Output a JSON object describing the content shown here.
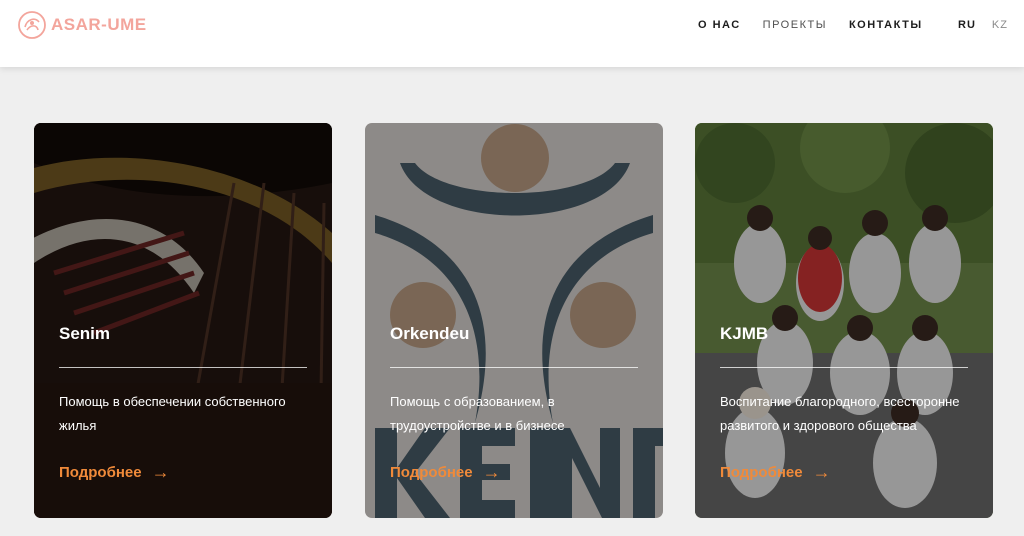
{
  "header": {
    "logo_text": "ASAR-UME",
    "nav": [
      {
        "label": "О НАС"
      },
      {
        "label": "ПРОЕКТЫ"
      },
      {
        "label": "КОНТАКТЫ"
      }
    ],
    "languages": [
      {
        "label": "RU",
        "active": true
      },
      {
        "label": "KZ",
        "active": false
      }
    ]
  },
  "cards": [
    {
      "title": "Senim",
      "description": "Помощь в обеспечении собственного жилья",
      "link": "Подробнее",
      "arrow": "→"
    },
    {
      "title": "Orkendeu",
      "description": "Помощь с образованием, в трудоустройстве и в бизнесе",
      "link": "Подробнее",
      "arrow": "→"
    },
    {
      "title": "KJMB",
      "description": "Воспитание благородного, всесторонне развитого и здорового общества",
      "link": "Подробнее",
      "arrow": "→"
    }
  ],
  "colors": {
    "accent": "#f08a3a",
    "logo": "#f3a59c",
    "navy": "#1f3d4f",
    "bronze": "#c69a73"
  }
}
